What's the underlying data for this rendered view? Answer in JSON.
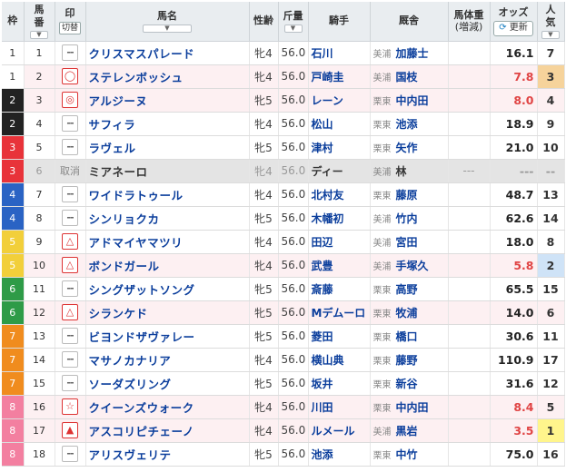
{
  "headers": {
    "waku": "枠",
    "umaban_l1": "馬",
    "umaban_l2": "番",
    "mark": "印",
    "kiri": "切替",
    "name": "馬名",
    "sex": "性齢",
    "kinryo": "斤量",
    "jockey": "騎手",
    "stable": "厩舎",
    "weight_l1": "馬体重",
    "weight_l2": "(増減)",
    "odds": "オッズ",
    "update": "更新",
    "pop_l1": "人",
    "pop_l2": "気"
  },
  "colors": {
    "accent": "#0b3e9c",
    "odds_red": "#e04444",
    "pink_row": "#fdf0f2"
  },
  "horses": [
    {
      "waku": "1",
      "umaban": "1",
      "mark": "--",
      "name": "クリスマスパレード",
      "sex": "牝4",
      "kin": "56.0",
      "jockey": "石川",
      "belong": "美浦",
      "trainer": "加藤士",
      "weight": "",
      "odds": "16.1",
      "pop": "7"
    },
    {
      "waku": "1",
      "umaban": "2",
      "mark": "◯",
      "name": "ステレンボッシュ",
      "sex": "牝4",
      "kin": "56.0",
      "jockey": "戸崎圭",
      "belong": "美浦",
      "trainer": "国枝",
      "weight": "",
      "odds": "7.8",
      "pop": "3"
    },
    {
      "waku": "2",
      "umaban": "3",
      "mark": "◎",
      "name": "アルジーヌ",
      "sex": "牝5",
      "kin": "56.0",
      "jockey": "レーン",
      "belong": "栗東",
      "trainer": "中内田",
      "weight": "",
      "odds": "8.0",
      "pop": "4"
    },
    {
      "waku": "2",
      "umaban": "4",
      "mark": "--",
      "name": "サフィラ",
      "sex": "牝4",
      "kin": "56.0",
      "jockey": "松山",
      "belong": "栗東",
      "trainer": "池添",
      "weight": "",
      "odds": "18.9",
      "pop": "9"
    },
    {
      "waku": "3",
      "umaban": "5",
      "mark": "--",
      "name": "ラヴェル",
      "sex": "牝5",
      "kin": "56.0",
      "jockey": "津村",
      "belong": "栗東",
      "trainer": "矢作",
      "weight": "",
      "odds": "21.0",
      "pop": "10"
    },
    {
      "waku": "3",
      "umaban": "6",
      "status": "取消",
      "mark": "",
      "name": "ミアネーロ",
      "sex": "牝4",
      "kin": "56.0",
      "jockey": "ディー",
      "belong": "美浦",
      "trainer": "林",
      "weight": "---",
      "odds": "---",
      "pop": "--"
    },
    {
      "waku": "4",
      "umaban": "7",
      "mark": "--",
      "name": "ワイドラトゥール",
      "sex": "牝4",
      "kin": "56.0",
      "jockey": "北村友",
      "belong": "栗東",
      "trainer": "藤原",
      "weight": "",
      "odds": "48.7",
      "pop": "13"
    },
    {
      "waku": "4",
      "umaban": "8",
      "mark": "--",
      "name": "シンリョクカ",
      "sex": "牝5",
      "kin": "56.0",
      "jockey": "木幡初",
      "belong": "美浦",
      "trainer": "竹内",
      "weight": "",
      "odds": "62.6",
      "pop": "14"
    },
    {
      "waku": "5",
      "umaban": "9",
      "mark": "△",
      "name": "アドマイヤマツリ",
      "sex": "牝4",
      "kin": "56.0",
      "jockey": "田辺",
      "belong": "美浦",
      "trainer": "宮田",
      "weight": "",
      "odds": "18.0",
      "pop": "8"
    },
    {
      "waku": "5",
      "umaban": "10",
      "mark": "△",
      "name": "ボンドガール",
      "sex": "牝4",
      "kin": "56.0",
      "jockey": "武豊",
      "belong": "美浦",
      "trainer": "手塚久",
      "weight": "",
      "odds": "5.8",
      "pop": "2"
    },
    {
      "waku": "6",
      "umaban": "11",
      "mark": "--",
      "name": "シングザットソング",
      "sex": "牝5",
      "kin": "56.0",
      "jockey": "斎藤",
      "belong": "栗東",
      "trainer": "高野",
      "weight": "",
      "odds": "65.5",
      "pop": "15"
    },
    {
      "waku": "6",
      "umaban": "12",
      "mark": "△",
      "name": "シランケド",
      "sex": "牝5",
      "kin": "56.0",
      "jockey": "Mデムーロ",
      "belong": "栗東",
      "trainer": "牧浦",
      "weight": "",
      "odds": "14.0",
      "pop": "6"
    },
    {
      "waku": "7",
      "umaban": "13",
      "mark": "--",
      "name": "ビヨンドザヴァレー",
      "sex": "牝5",
      "kin": "56.0",
      "jockey": "菱田",
      "belong": "栗東",
      "trainer": "橋口",
      "weight": "",
      "odds": "30.6",
      "pop": "11"
    },
    {
      "waku": "7",
      "umaban": "14",
      "mark": "--",
      "name": "マサノカナリア",
      "sex": "牝4",
      "kin": "56.0",
      "jockey": "横山典",
      "belong": "栗東",
      "trainer": "藤野",
      "weight": "",
      "odds": "110.9",
      "pop": "17"
    },
    {
      "waku": "7",
      "umaban": "15",
      "mark": "--",
      "name": "ソーダズリング",
      "sex": "牝5",
      "kin": "56.0",
      "jockey": "坂井",
      "belong": "栗東",
      "trainer": "新谷",
      "weight": "",
      "odds": "31.6",
      "pop": "12"
    },
    {
      "waku": "8",
      "umaban": "16",
      "mark": "☆",
      "name": "クイーンズウォーク",
      "sex": "牝4",
      "kin": "56.0",
      "jockey": "川田",
      "belong": "栗東",
      "trainer": "中内田",
      "weight": "",
      "odds": "8.4",
      "pop": "5"
    },
    {
      "waku": "8",
      "umaban": "17",
      "mark": "▲",
      "name": "アスコリピチェーノ",
      "sex": "牝4",
      "kin": "56.0",
      "jockey": "ルメール",
      "belong": "美浦",
      "trainer": "黒岩",
      "weight": "",
      "odds": "3.5",
      "pop": "1"
    },
    {
      "waku": "8",
      "umaban": "18",
      "mark": "--",
      "name": "アリスヴェリテ",
      "sex": "牝5",
      "kin": "56.0",
      "jockey": "池添",
      "belong": "栗東",
      "trainer": "中竹",
      "weight": "",
      "odds": "75.0",
      "pop": "16"
    }
  ]
}
